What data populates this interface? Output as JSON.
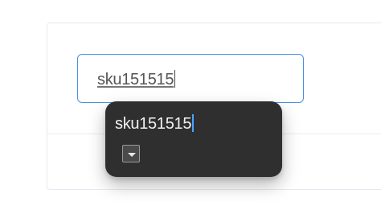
{
  "search": {
    "value": "sku151515"
  },
  "suggestion_popup": {
    "value": "sku151515",
    "dropdown_icon": "triangle-down-icon"
  }
}
